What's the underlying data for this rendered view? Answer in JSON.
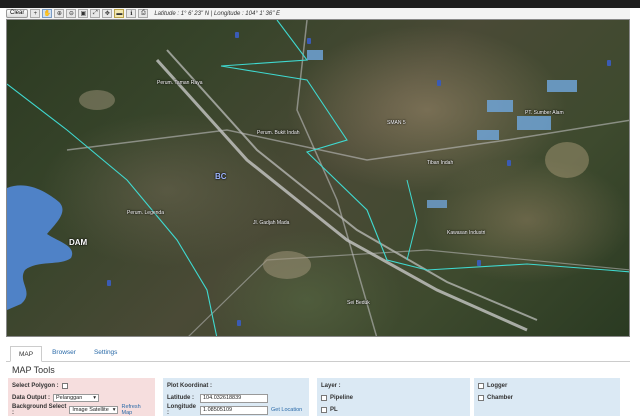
{
  "toolbar": {
    "clear_label": "Clear",
    "coordinate_readout": "Latitude : 1° 6' 23\" N | Longitude : 104° 1' 36\" E",
    "icons": [
      "plus-icon",
      "hand-icon",
      "zoom-in-icon",
      "zoom-out-icon",
      "zoom-box-icon",
      "fit-icon",
      "move-icon",
      "ruler-icon",
      "identify-icon",
      "print-icon"
    ]
  },
  "map": {
    "labels": {
      "dam": "DAM",
      "district": "BC",
      "road": "Jl. Gadjah Mada",
      "sample1": "Perum. Bukit Indah",
      "sample2": "PT. Sumber Alam",
      "sample3": "Tiban Indah",
      "sample4": "Perum. Legenda",
      "sample5": "Kawasan Industri",
      "sample6": "Sei Beduk",
      "sample7": "Perum. Taman Raya",
      "sample8": "SMAN 5"
    },
    "colors": {
      "boundary": "#3fd9d0",
      "water": "#4f82c7",
      "road": "#d8d8d8"
    }
  },
  "tabs": [
    "MAP",
    "Browser",
    "Settings"
  ],
  "tools_title": "MAP Tools",
  "panel_select": {
    "select_polygon_label": "Select Polygon :",
    "data_output_label": "Data Output :",
    "data_output_value": "Pelanggan",
    "background_label": "Background Select :",
    "background_value": "Image Satellite",
    "refresh_label": "Refresh Map"
  },
  "panel_plot": {
    "title": "Plot Koordinat :",
    "latitude_label": "Latitude :",
    "latitude_value": "104.032618839",
    "longitude_label": "Longitude :",
    "longitude_value": "1.08505109",
    "get_location_label": "Get Location"
  },
  "panel_layer": {
    "title": "Layer :",
    "pipeline_label": "Pipeline",
    "pl_label": "PL"
  },
  "panel_extra": {
    "logger_label": "Logger",
    "chamber_label": "Chamber"
  }
}
